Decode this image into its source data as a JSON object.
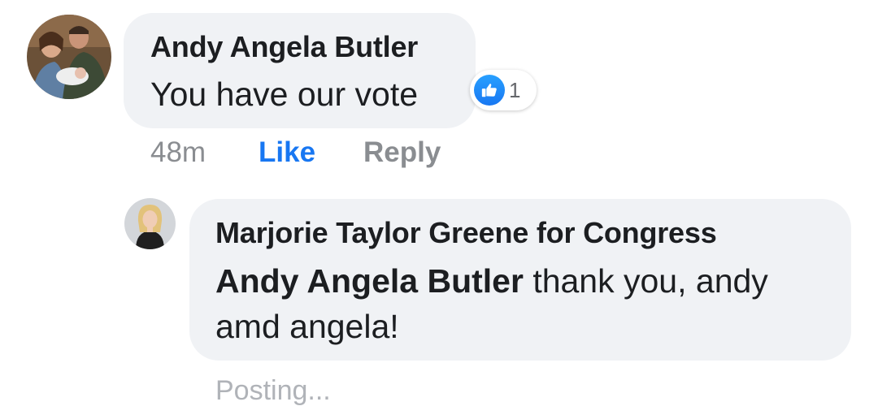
{
  "comment": {
    "author": "Andy Angela Butler",
    "text": "You have our vote",
    "reaction": {
      "icon": "thumbs-up-icon",
      "count": "1",
      "color": "#1877f2"
    },
    "timestamp": "48m",
    "like_label": "Like",
    "reply_label": "Reply"
  },
  "reply": {
    "author": "Marjorie Taylor Greene for Congress",
    "mention": "Andy Angela Butler",
    "text": " thank you, andy amd angela!",
    "status": "Posting..."
  }
}
